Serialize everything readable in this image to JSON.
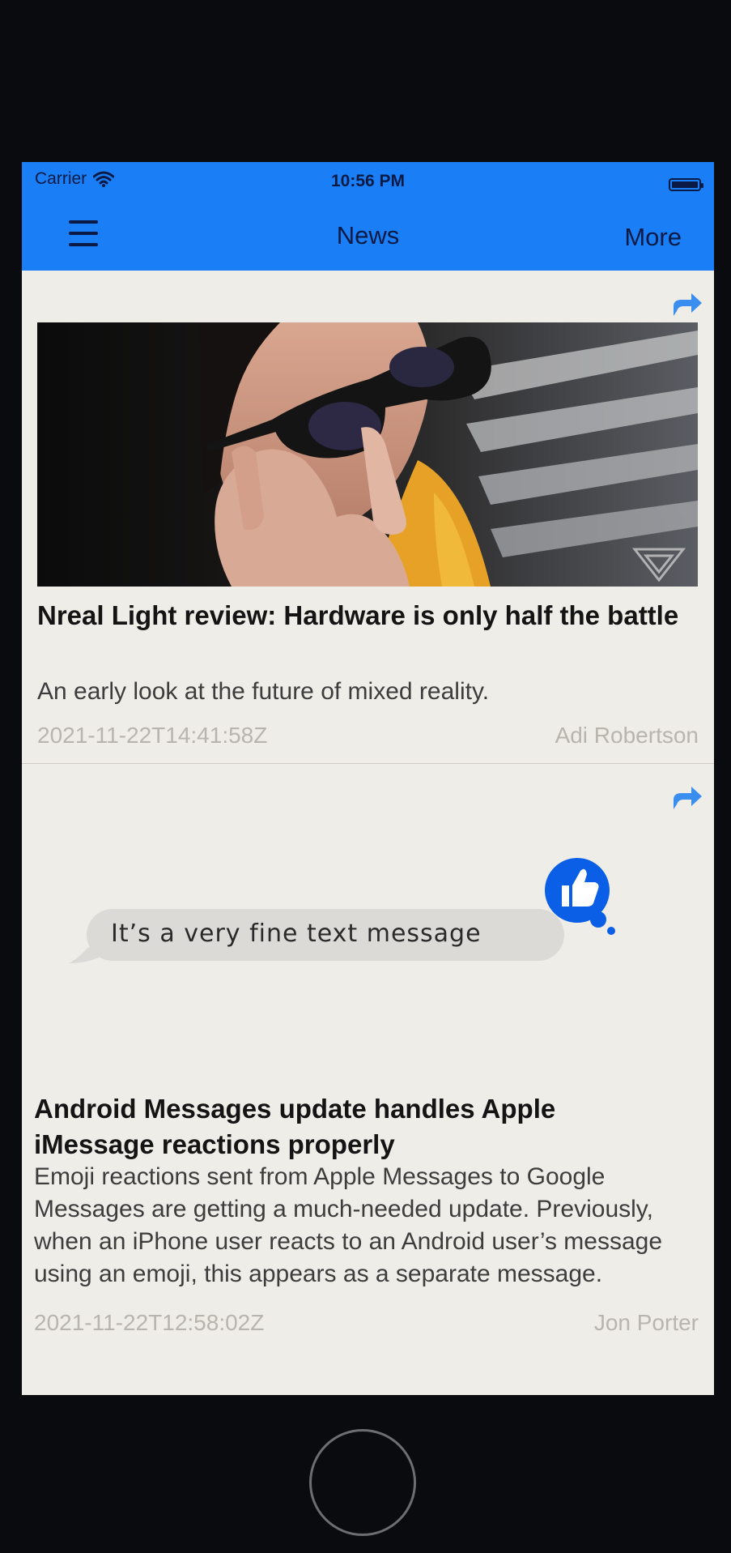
{
  "status_bar": {
    "carrier": "Carrier",
    "time": "10:56 PM"
  },
  "nav": {
    "title": "News",
    "more_label": "More",
    "menu_icon": "hamburger-menu-icon"
  },
  "articles": [
    {
      "title": "Nreal Light review: Hardware is only half the battle",
      "summary": "An early look at the future of mixed reality.",
      "timestamp": "2021-11-22T14:41:58Z",
      "author": "Adi Robertson",
      "share_icon": "share-icon"
    },
    {
      "thumbnail_text": "It’s a very fine text message",
      "title": "Android Messages update handles Apple iMessage reactions properly",
      "summary": "Emoji reactions sent from Apple Messages to Google Messages are getting a much-needed update. Previously, when an iPhone user reacts to an Android user’s message using an emoji, this appears as a separate message.",
      "timestamp": "2021-11-22T12:58:02Z",
      "author": "Jon Porter",
      "share_icon": "share-icon"
    }
  ],
  "colors": {
    "accent": "#1a7ff6",
    "nav_text": "#0b1a44",
    "background": "#efede8",
    "meta_text": "#b8b4ae",
    "thumbs_up_bubble": "#0a5fe6"
  }
}
